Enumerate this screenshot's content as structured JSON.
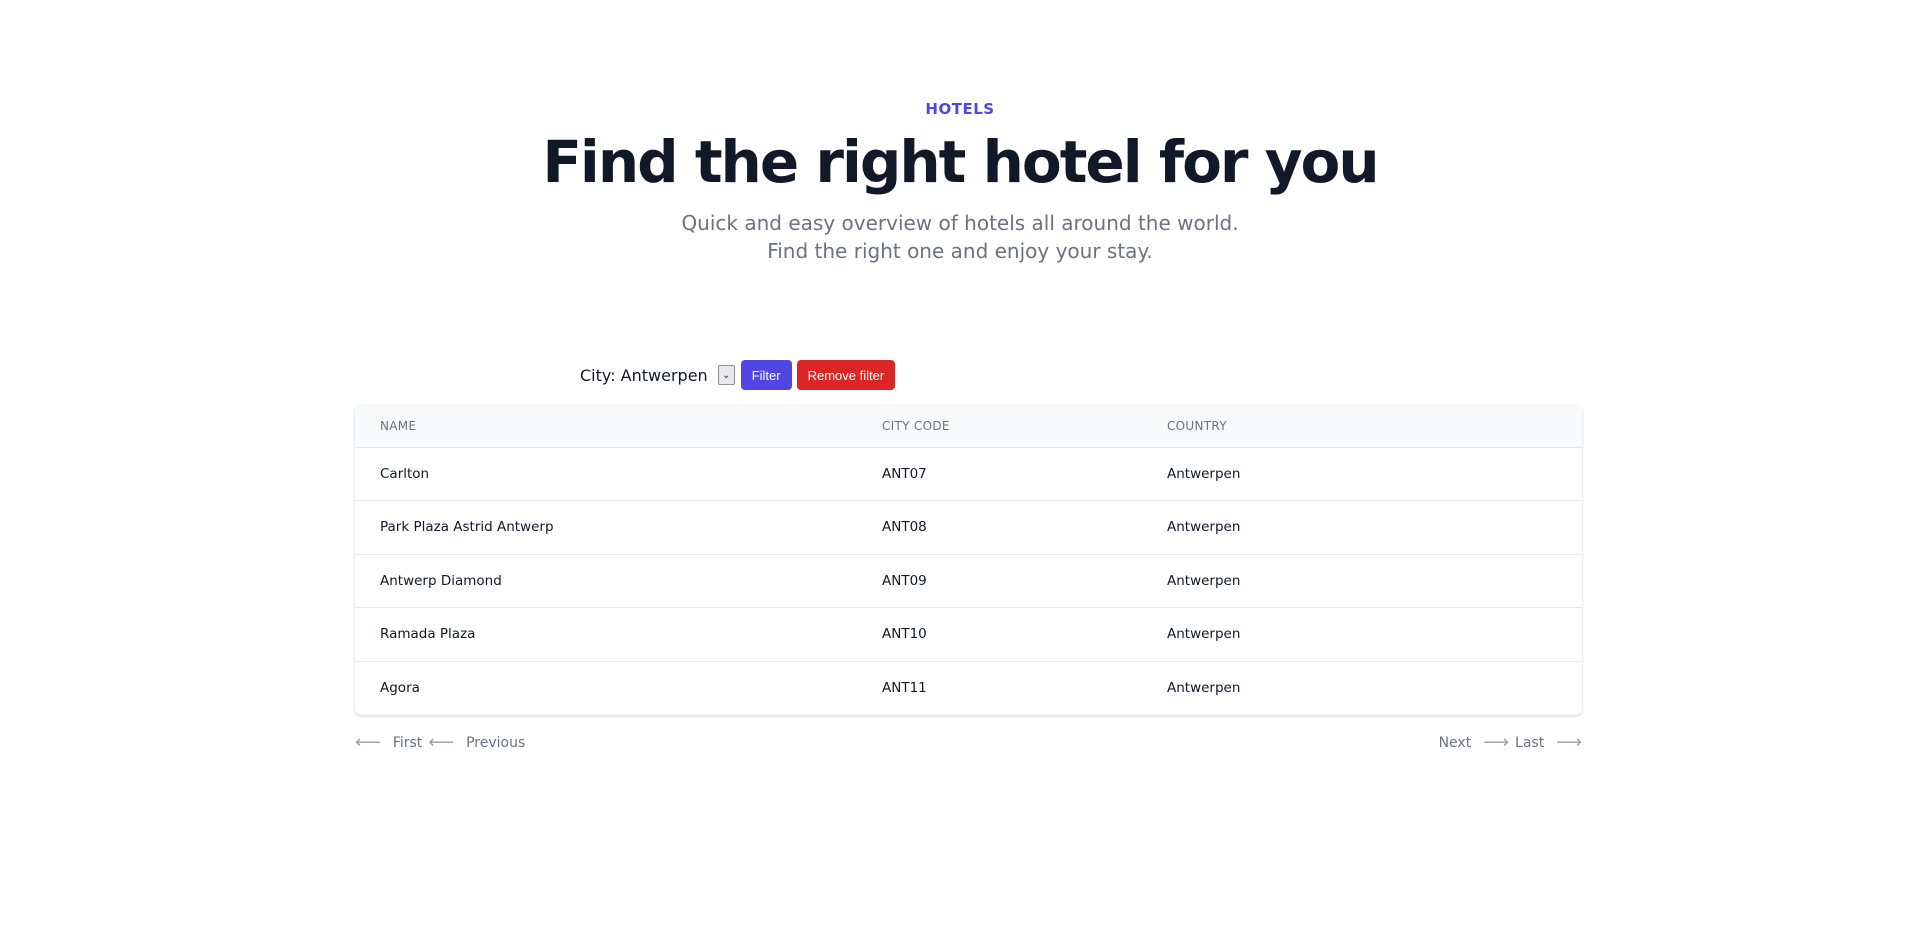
{
  "hero": {
    "eyebrow": "HOTELS",
    "title": "Find the right hotel for you",
    "subtitle": "Quick and easy overview of hotels all around the world. Find the right one and enjoy your stay."
  },
  "filter": {
    "label": "City: Antwerpen",
    "filter_button": "Filter",
    "remove_button": "Remove filter"
  },
  "table": {
    "headers": [
      "Name",
      "City code",
      "Country"
    ],
    "rows": [
      [
        "Carlton",
        "ANT07",
        "Antwerpen"
      ],
      [
        "Park Plaza Astrid Antwerp",
        "ANT08",
        "Antwerpen"
      ],
      [
        "Antwerp Diamond",
        "ANT09",
        "Antwerpen"
      ],
      [
        "Ramada Plaza",
        "ANT10",
        "Antwerpen"
      ],
      [
        "Agora",
        "ANT11",
        "Antwerpen"
      ]
    ]
  },
  "pagination": {
    "first": "First",
    "previous": "Previous",
    "next": "Next",
    "last": "Last"
  },
  "icons": {
    "arrow_left": "arrow-left-icon",
    "arrow_right": "arrow-right-icon",
    "select_chevron": "chevron-down-icon"
  },
  "colors": {
    "accent": "#4f46e5",
    "danger": "#dc2626",
    "text": "#111827",
    "muted": "#6b7280"
  }
}
